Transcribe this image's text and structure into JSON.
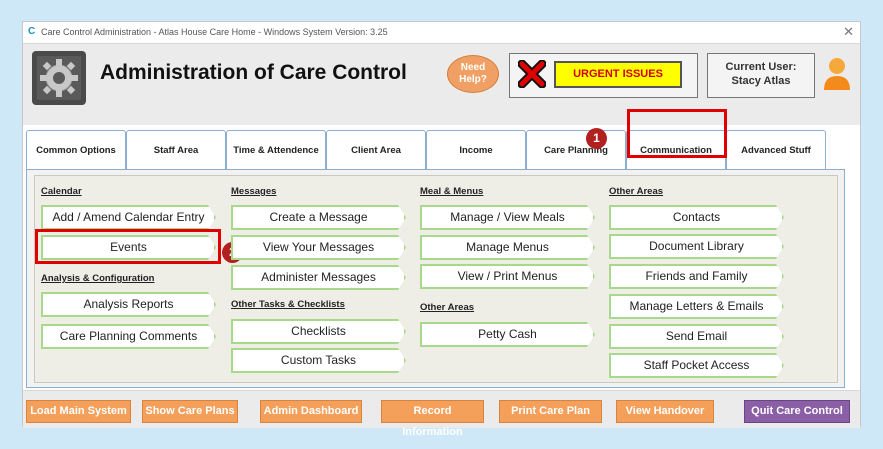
{
  "window": {
    "title": "Care Control Administration - Atlas House Care Home - Windows System Version: 3.25",
    "app_icon": "C",
    "close_glyph": "✕"
  },
  "header": {
    "app_title": "Administration of Care Control",
    "help_button": "Need Help?",
    "urgent_label": "URGENT ISSUES",
    "current_user_label": "Current User:",
    "current_user_name": "Stacy Atlas"
  },
  "tabs": [
    "Common Options",
    "Staff Area",
    "Time & Attendence",
    "Client Area",
    "Income",
    "Care Planning",
    "Communication",
    "Advanced Stuff"
  ],
  "sections": {
    "calendar": {
      "heading": "Calendar",
      "buttons": [
        "Add / Amend Calendar Entry",
        "Events"
      ]
    },
    "analysis": {
      "heading": "Analysis & Configuration",
      "buttons": [
        "Analysis Reports",
        "Care Planning Comments"
      ]
    },
    "messages": {
      "heading": "Messages",
      "buttons": [
        "Create a Message",
        "View Your Messages",
        "Administer Messages"
      ]
    },
    "other_tasks": {
      "heading": "Other Tasks & Checklists",
      "buttons": [
        "Checklists",
        "Custom Tasks"
      ]
    },
    "meals": {
      "heading": "Meal & Menus",
      "buttons": [
        "Manage / View Meals",
        "Manage Menus",
        "View / Print Menus"
      ]
    },
    "other_areas_mid": {
      "heading": "Other Areas",
      "buttons": [
        "Petty Cash"
      ]
    },
    "other_areas_right": {
      "heading": "Other Areas",
      "buttons": [
        "Contacts",
        "Document Library",
        "Friends and Family",
        "Manage Letters & Emails",
        "Send Email",
        "Staff Pocket Access"
      ]
    }
  },
  "markers": [
    "1",
    "2"
  ],
  "footer": [
    "Load Main System",
    "Show Care Plans",
    "Admin Dashboard",
    "Record Information",
    "Print Care Plan",
    "View Handover",
    "Quit Care Control"
  ],
  "colors": {
    "highlight": "#e00000",
    "button_border": "#a8d88a",
    "footer_orange": "#f5a05a",
    "footer_purple": "#8a5fa6",
    "urgent_yellow": "#ffff00"
  },
  "icons": [
    "app-icon",
    "gear-logo-icon",
    "red-x-icon",
    "user-avatar-icon",
    "close-icon"
  ]
}
